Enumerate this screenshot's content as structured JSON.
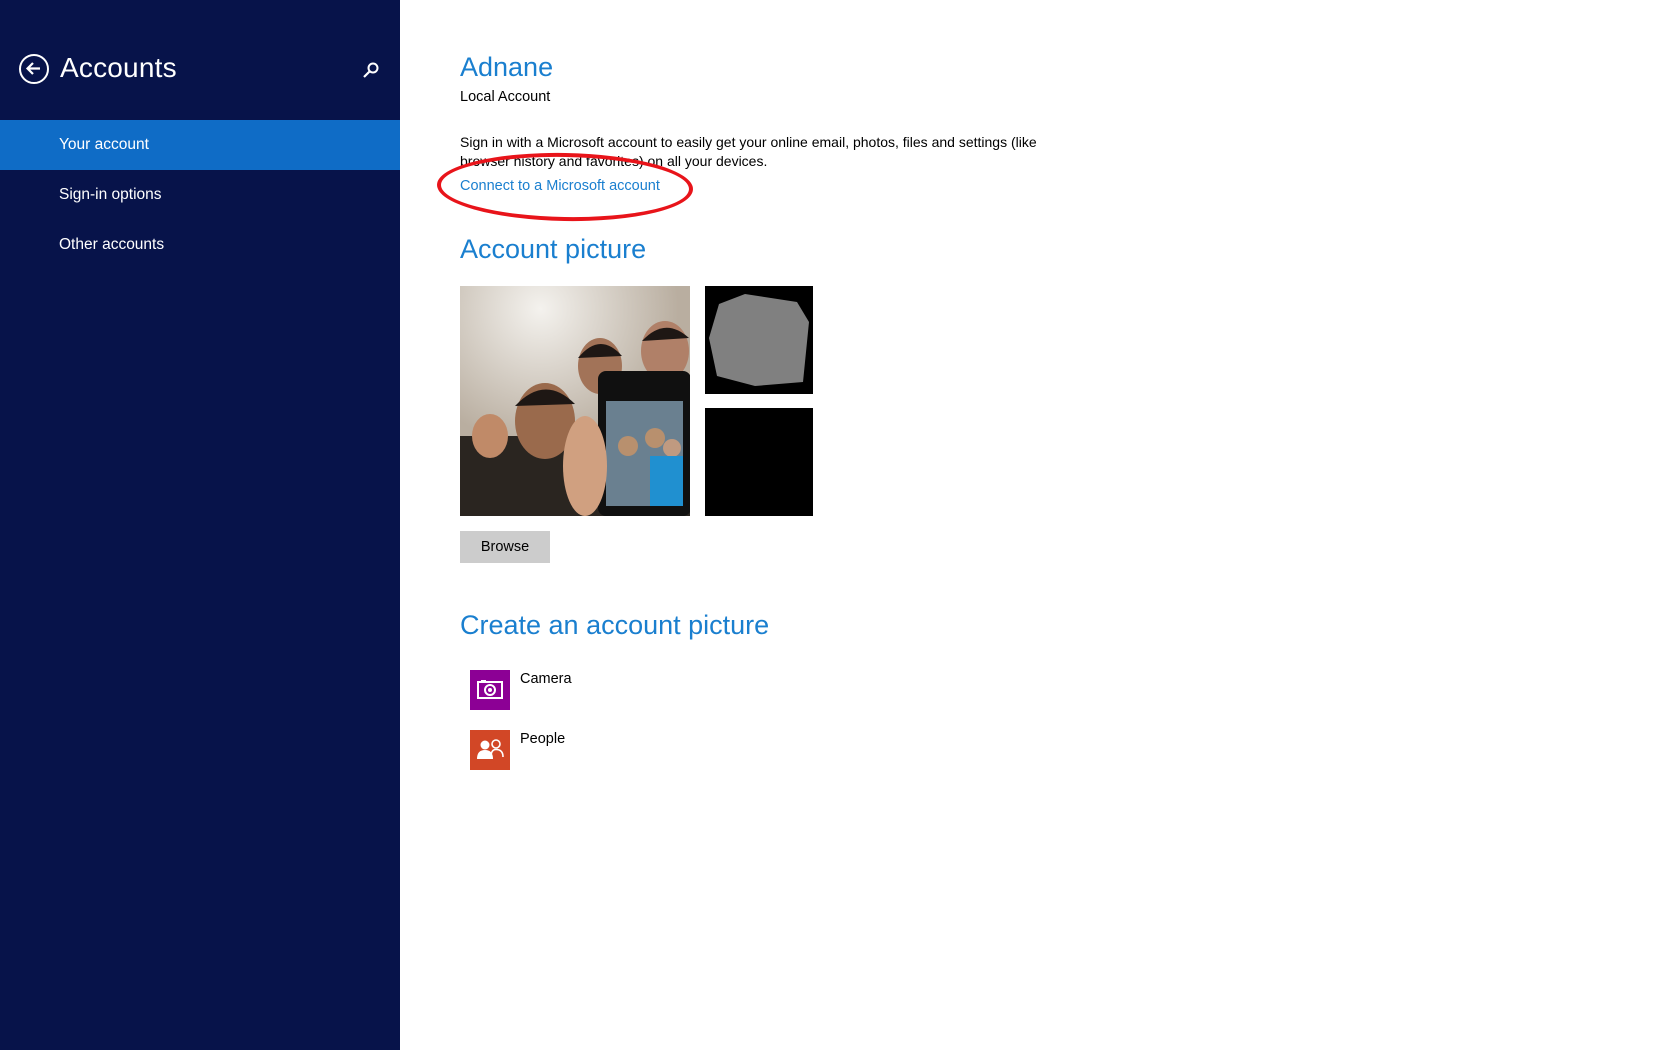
{
  "sidebar": {
    "title": "Accounts",
    "back_icon": "back-arrow-icon",
    "search_icon": "search-icon",
    "items": [
      {
        "label": "Your account",
        "selected": true
      },
      {
        "label": "Sign-in options",
        "selected": false
      },
      {
        "label": "Other accounts",
        "selected": false
      }
    ]
  },
  "account": {
    "name": "Adnane",
    "type": "Local Account",
    "signin_text": "Sign in with a Microsoft account to easily get your online email, photos, files and settings (like browser history and favorites) on all your devices.",
    "connect_link": "Connect to a Microsoft account"
  },
  "picture_section": {
    "title": "Account picture",
    "browse_label": "Browse"
  },
  "create_section": {
    "title": "Create an account picture",
    "apps": [
      {
        "label": "Camera",
        "icon": "camera-icon",
        "color": "#8c0095"
      },
      {
        "label": "People",
        "icon": "people-icon",
        "color": "#d24726"
      }
    ]
  },
  "colors": {
    "sidebar_bg": "#07134a",
    "selected_bg": "#0f6cc6",
    "accent": "#1a7fcf",
    "annotation": "#e8141a"
  }
}
